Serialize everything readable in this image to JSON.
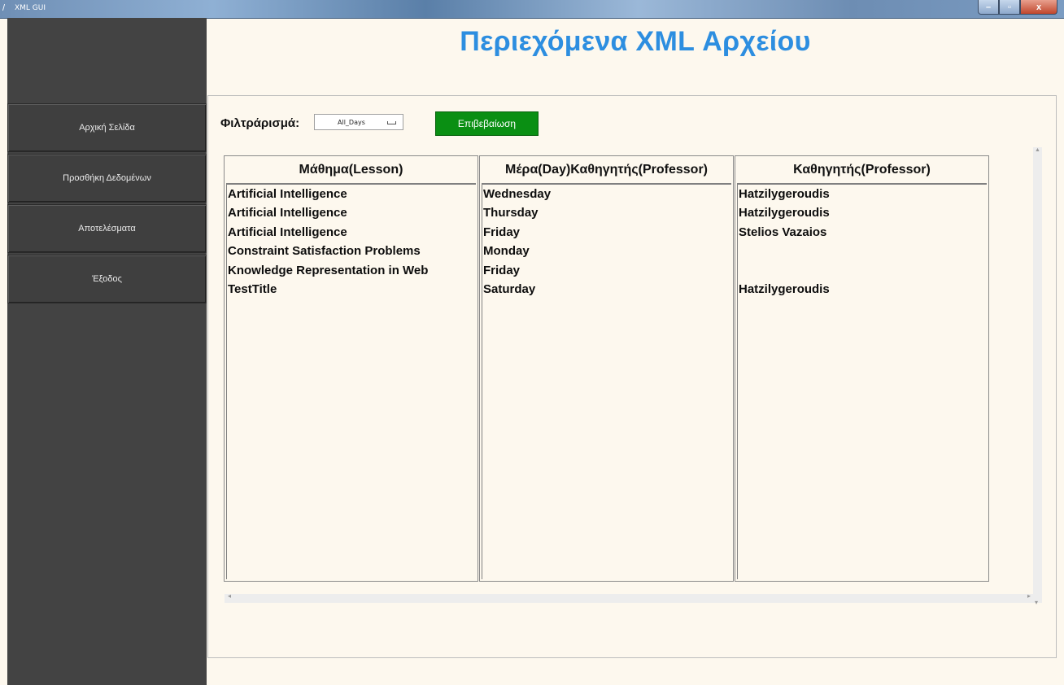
{
  "window": {
    "title": "XML GUI",
    "icons": {
      "app": "feather-icon",
      "minimize": "minimize-icon",
      "maximize": "maximize-icon",
      "close": "close-icon"
    }
  },
  "sidebar": {
    "items": [
      {
        "label": "Αρχική Σελίδα"
      },
      {
        "label": "Προσθήκη Δεδομένων"
      },
      {
        "label": "Αποτελέσματα"
      },
      {
        "label": "Έξοδος"
      }
    ]
  },
  "main": {
    "title": "Περιεχόμενα XML Αρχείου",
    "accent_color": "#2d8ee0",
    "filter": {
      "label": "Φιλτράρισμά:",
      "selected": "All_Days",
      "confirm_label": "Επιβεβαίωση",
      "confirm_color": "#0a8f13"
    },
    "columns": [
      {
        "header": "Μάθημα(Lesson)",
        "rows": [
          "Artificial Intelligence",
          "Artificial Intelligence",
          "Artificial Intelligence",
          "Constraint Satisfaction Problems",
          "Knowledge Representation in Web",
          "TestTitle"
        ]
      },
      {
        "header": "Μέρα(Day)Καθηγητής(Professor)",
        "rows": [
          "Wednesday",
          "Thursday",
          "Friday",
          "Monday",
          "Friday",
          "Saturday"
        ]
      },
      {
        "header": "Καθηγητής(Professor)",
        "rows": [
          "Hatzilygeroudis",
          "Hatzilygeroudis",
          "Stelios Vazaios",
          "",
          "",
          "Hatzilygeroudis"
        ]
      }
    ]
  }
}
